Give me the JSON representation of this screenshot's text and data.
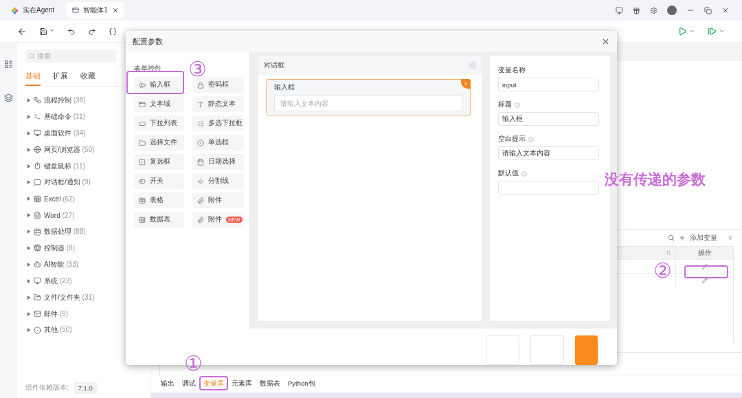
{
  "app_tabs": [
    {
      "label": "实在Agent",
      "selected": false
    },
    {
      "label": "智能体1",
      "selected": true
    }
  ],
  "sidebar": {
    "search": {
      "placeholder": "搜索"
    },
    "tabs": [
      {
        "label": "基础",
        "selected": true
      },
      {
        "label": "扩展",
        "selected": false
      },
      {
        "label": "收藏",
        "selected": false
      }
    ],
    "items": [
      {
        "label": "流程控制",
        "count": "(38)",
        "expanded": false
      },
      {
        "label": "基础命令",
        "count": "(11)",
        "expanded": false
      },
      {
        "label": "桌面软件",
        "count": "(34)",
        "expanded": false
      },
      {
        "label": "网页/浏览器",
        "count": "(50)",
        "expanded": false
      },
      {
        "label": "键盘鼠标",
        "count": "(11)",
        "expanded": false
      },
      {
        "label": "对话框/通知",
        "count": "(9)",
        "expanded": false
      },
      {
        "label": "Excel",
        "count": "(62)",
        "expanded": false
      },
      {
        "label": "Word",
        "count": "(27)",
        "expanded": false
      },
      {
        "label": "数据处理",
        "count": "(88)",
        "expanded": false
      },
      {
        "label": "控制器",
        "count": "(8)",
        "expanded": false
      },
      {
        "label": "AI智能",
        "count": "(33)",
        "expanded": false
      },
      {
        "label": "系统",
        "count": "(23)",
        "expanded": false
      },
      {
        "label": "文件/文件夹",
        "count": "(31)",
        "expanded": false
      },
      {
        "label": "邮件",
        "count": "(9)",
        "expanded": false
      },
      {
        "label": "其他",
        "count": "(50)",
        "expanded": false
      }
    ],
    "footer": {
      "label": "组件依赖版本:",
      "version": "7.1.0"
    }
  },
  "variables_panel": {
    "add_label": "添加变量",
    "columns": [
      {
        "kind": "sortable"
      },
      {
        "kind": "text",
        "label": "操作"
      }
    ],
    "rows": [
      {
        "kind": "editable"
      },
      {
        "kind": "editable"
      }
    ]
  },
  "bottom_tabs": [
    {
      "label": "输出",
      "selected": false
    },
    {
      "label": "调试",
      "selected": false
    },
    {
      "label": "变量库",
      "selected": true
    },
    {
      "label": "元素库",
      "selected": false
    },
    {
      "label": "数据表",
      "selected": false
    },
    {
      "label": "Python包",
      "selected": false
    }
  ],
  "dialog": {
    "title": "配置参数",
    "palette": {
      "heading": "表单控件",
      "controls": [
        {
          "label": "输入框"
        },
        {
          "label": "密码框"
        },
        {
          "label": "文本域"
        },
        {
          "label": "静态文本"
        },
        {
          "label": "下拉列表"
        },
        {
          "label": "多选下拉框"
        },
        {
          "label": "选择文件"
        },
        {
          "label": "单选框"
        },
        {
          "label": "复选框"
        },
        {
          "label": "日期选择"
        },
        {
          "label": "开关"
        },
        {
          "label": "分割线"
        },
        {
          "label": "表格"
        },
        {
          "label": "附件"
        },
        {
          "label": "数据表"
        },
        {
          "label": "附件",
          "badge": "NEW"
        }
      ]
    },
    "canvas": {
      "title": "对话框",
      "fields": [
        {
          "label": "输入框",
          "placeholder": "请输入文本内容",
          "selected": true
        }
      ]
    },
    "properties": [
      {
        "label": "变量名称",
        "value": "input",
        "info": false
      },
      {
        "label": "标题",
        "value": "输入框",
        "info": true
      },
      {
        "label": "空白提示",
        "value": "请输入文本内容",
        "info": true
      },
      {
        "label": "默认值",
        "info": true
      }
    ],
    "footer_buttons": [
      {
        "kind": "outline"
      },
      {
        "kind": "outline"
      },
      {
        "kind": "primary"
      }
    ]
  },
  "annotations": [
    {
      "mark": "③"
    },
    {
      "mark": "①"
    },
    {
      "mark": "②"
    }
  ],
  "note": "没有传递的参数"
}
